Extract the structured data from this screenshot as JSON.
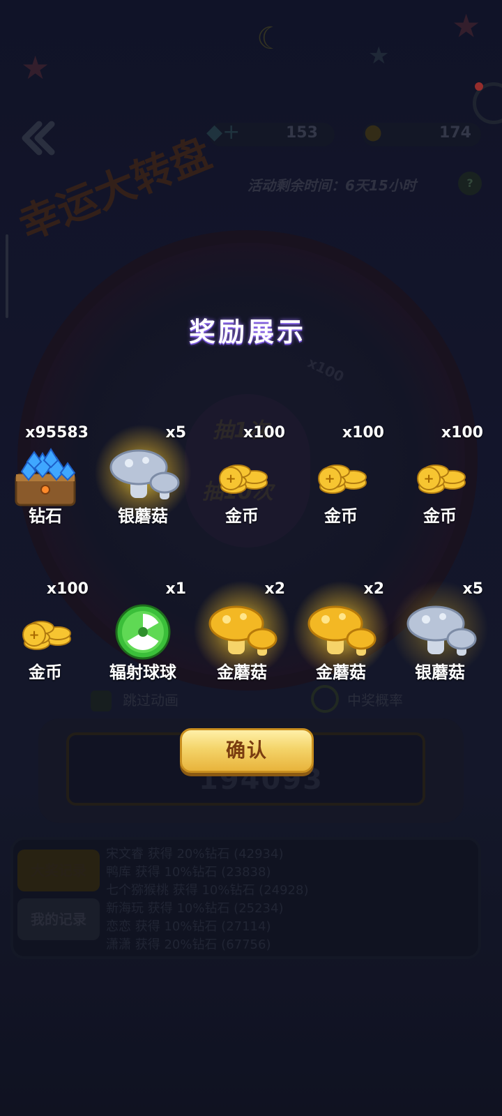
{
  "background": {
    "resources": [
      {
        "icon": "diamond-plus-icon",
        "value": "153"
      },
      {
        "icon": "gold-mushroom-icon",
        "value": "174"
      }
    ],
    "timer": "活动剩余时间：6天15小时",
    "game_title": "幸运大转盘",
    "wheel": {
      "button_once": "抽1次",
      "button_ten": "抽10次",
      "multiplier_label": "x100"
    },
    "skip_animation": "跳过动画",
    "win_probability": "中奖概率",
    "machine_counter": "194093",
    "record_tabs": [
      "大奖记录",
      "我的记录"
    ],
    "record_lines": [
      "宋文睿 获得 20%钻石 (42934)",
      "鸭库 获得 10%钻石 (23838)",
      "七个猕猴桃 获得 10%钻石 (24928)",
      "新海玩 获得 10%钻石 (25234)",
      "恋恋 获得 10%钻石 (27114)",
      "潇潇 获得 20%钻石 (67756)"
    ]
  },
  "reward_dialog": {
    "title": "奖励展示",
    "confirm_label": "确认",
    "items": [
      {
        "name": "钻石",
        "qty": "x95583",
        "icon": "diamond-chest-icon",
        "glow": false
      },
      {
        "name": "银蘑菇",
        "qty": "x5",
        "icon": "silver-mushroom-icon",
        "glow": true
      },
      {
        "name": "金币",
        "qty": "x100",
        "icon": "gold-coin-icon",
        "glow": false
      },
      {
        "name": "金币",
        "qty": "x100",
        "icon": "gold-coin-icon",
        "glow": false
      },
      {
        "name": "金币",
        "qty": "x100",
        "icon": "gold-coin-icon",
        "glow": false
      },
      {
        "name": "金币",
        "qty": "x100",
        "icon": "gold-coin-icon",
        "glow": false
      },
      {
        "name": "辐射球球",
        "qty": "x1",
        "icon": "radiation-ball-icon",
        "glow": false
      },
      {
        "name": "金蘑菇",
        "qty": "x2",
        "icon": "gold-mushroom-icon",
        "glow": true
      },
      {
        "name": "金蘑菇",
        "qty": "x2",
        "icon": "gold-mushroom-icon",
        "glow": true
      },
      {
        "name": "银蘑菇",
        "qty": "x5",
        "icon": "silver-mushroom-icon",
        "glow": true
      }
    ]
  }
}
